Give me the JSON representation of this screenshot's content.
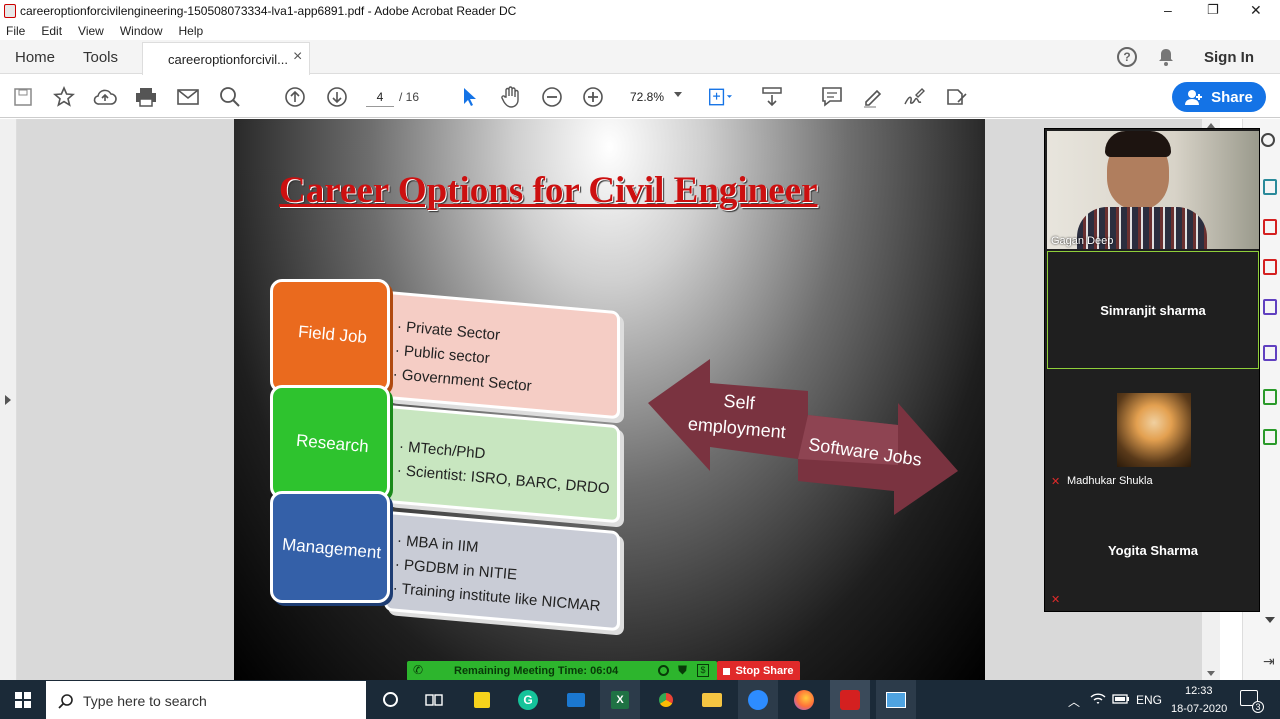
{
  "window": {
    "title": "careeroptionforcivilengineering-150508073334-lva1-app6891.pdf - Adobe Acrobat Reader DC",
    "controls": [
      "–",
      "❐",
      "✕"
    ]
  },
  "menu": [
    "File",
    "Edit",
    "View",
    "Window",
    "Help"
  ],
  "tabs": {
    "home": "Home",
    "tools": "Tools",
    "document": "careeroptionforcivil...",
    "close": "×",
    "sign_in": "Sign In"
  },
  "toolbar": {
    "page_current": "4",
    "page_total": "/ 16",
    "zoom": "72.8%",
    "share": "Share"
  },
  "slide": {
    "title": "Career Options for Civil Engineer",
    "boxes": [
      {
        "label": "Field Job",
        "color": "#ea6a1e",
        "items": [
          "· Private Sector",
          "· Public sector",
          "· Government Sector"
        ]
      },
      {
        "label": "Research",
        "color": "#2ec32e",
        "items": [
          "· MTech/PhD",
          "· Scientist: ISRO, BARC, DRDO"
        ]
      },
      {
        "label": "Management",
        "color": "#3460a8",
        "items": [
          "· MBA in IIM",
          "· PGDBM in NITIE",
          "· Training institute like NICMAR"
        ]
      }
    ],
    "arrow_left": [
      "Self",
      "employment"
    ],
    "arrow_right": "Software Jobs"
  },
  "meeting": {
    "participants": [
      {
        "name": "Gagan Deep",
        "type": "video"
      },
      {
        "name": "Simranjit sharma",
        "type": "name"
      },
      {
        "name": "Madhukar Shukla",
        "type": "avatar"
      },
      {
        "name": "Yogita Sharma",
        "type": "name"
      }
    ],
    "remaining": "Remaining Meeting Time: 06:04",
    "stop_share": "Stop Share"
  },
  "taskbar": {
    "search_placeholder": "Type here to search",
    "lang": "ENG",
    "time": "12:33",
    "date": "18-07-2020",
    "notif_count": "3"
  },
  "colors": {
    "accent": "#1473e6",
    "title_red": "#cc1010",
    "meeting_green": "#2db52d",
    "stop_red": "#e02a2a",
    "arrow": "#7a3340"
  }
}
